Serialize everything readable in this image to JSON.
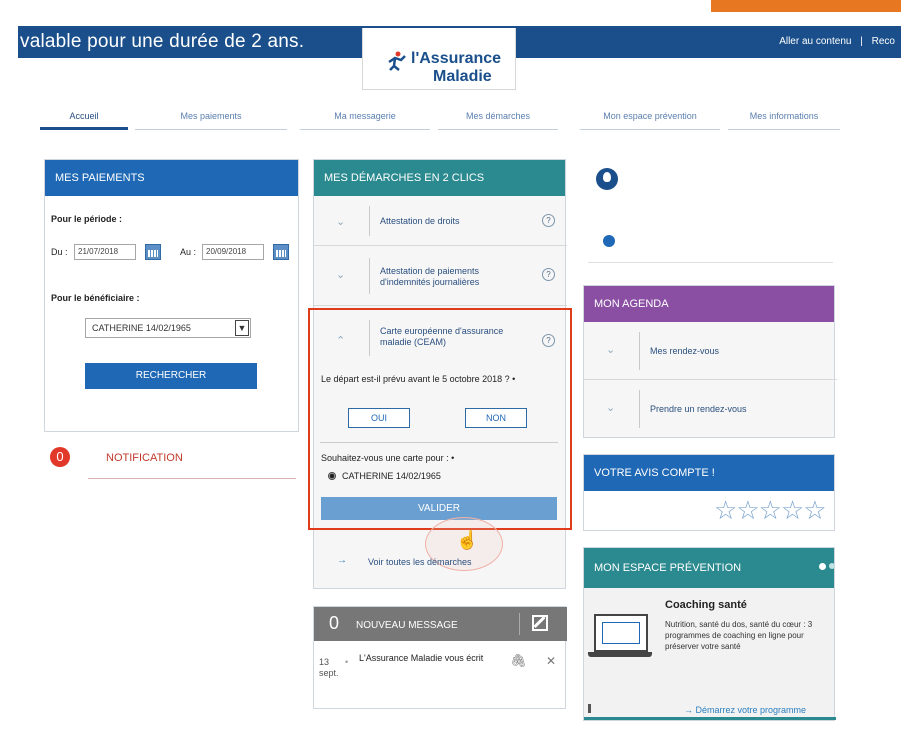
{
  "caption": "valable pour une durée de 2 ans.",
  "header": {
    "top_links": [
      "Aller au contenu",
      "|",
      "Reco"
    ],
    "logo_line1": "l'Assurance",
    "logo_line2": "Maladie"
  },
  "nav": {
    "items": [
      "Accueil",
      "Mes paiements",
      "Ma messagerie",
      "Mes démarches",
      "Mon espace prévention",
      "Mes informations"
    ],
    "active": "Accueil"
  },
  "payments": {
    "title": "MES PAIEMENTS",
    "period_label": "Pour le période :",
    "from_label": "Du :",
    "from_value": "21/07/2018",
    "to_label": "Au :",
    "to_value": "20/09/2018",
    "beneficiary_label": "Pour le bénéficiaire :",
    "beneficiary_value": "CATHERINE 14/02/1965",
    "search_button": "RECHERCHER"
  },
  "notification": {
    "count": "0",
    "label": "NOTIFICATION"
  },
  "demarches": {
    "title": "MES DÉMARCHES EN 2 CLICS",
    "items": [
      {
        "label": "Attestation de droits",
        "chevron": "⌄"
      },
      {
        "label": "Attestation de paiements d'indemnités journalières",
        "chevron": "⌄"
      },
      {
        "label": "Carte européenne d'assurance maladie (CEAM)",
        "chevron": "⌃"
      }
    ],
    "help_symbol": "?",
    "question": "Le départ est-il prévu avant le 5 octobre 2018 ? •",
    "yes_button": "OUI",
    "no_button": "NON",
    "card_for_label": "Souhaitez-vous une carte pour : •",
    "card_for_value": "CATHERINE 14/02/1965",
    "validate_button": "VALIDER",
    "see_all_arrow": "→",
    "see_all": "Voir toutes les démarches"
  },
  "messages": {
    "count": "0",
    "title": "NOUVEAU MESSAGE",
    "item_date": "13 sept.",
    "item_dot": "•",
    "item_text": "L'Assurance Maladie vous écrit",
    "clip_symbol": "🖇",
    "close_symbol": "✕"
  },
  "agenda": {
    "title": "MON AGENDA",
    "items": [
      "Mes rendez-vous",
      "Prendre un rendez-vous"
    ],
    "chevron": "⌄"
  },
  "avis": {
    "title": "VOTRE AVIS COMPTE !",
    "stars": "☆☆☆☆☆",
    "rating": 0
  },
  "prevention": {
    "title": "MON ESPACE PRÉVENTION",
    "card_title": "Coaching santé",
    "card_desc": "Nutrition, santé du dos, santé du cœur : 3 programmes de coaching en ligne pour préserver votre santé",
    "link": "→ Démarrez votre programme"
  },
  "colors": {
    "brand_blue": "#1a4f8b",
    "button_blue": "#1f68b5",
    "teal": "#2b8a8f",
    "purple": "#8a4fa3",
    "highlight_red": "#e03c1c",
    "orange": "#e87722"
  }
}
